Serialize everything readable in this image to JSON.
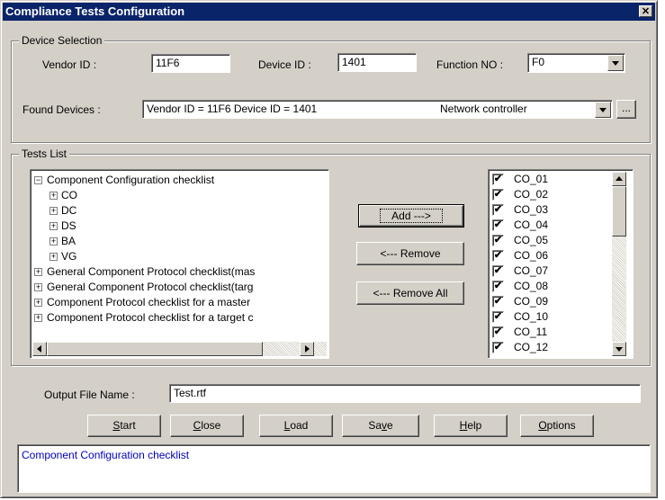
{
  "window": {
    "title": "Compliance Tests Configuration",
    "close_glyph": "✕"
  },
  "device_selection": {
    "legend": "Device Selection",
    "vendor_label": "Vendor ID :",
    "vendor_value": "11F6",
    "device_label": "Device ID :",
    "device_value": "1401",
    "function_label": "Function NO :",
    "function_value": "F0",
    "found_label": "Found Devices :",
    "found_value": "Vendor ID = 11F6 Device ID = 1401",
    "found_class": "Network controller",
    "browse_label": "..."
  },
  "tests_list": {
    "legend": "Tests List",
    "tree": [
      {
        "label": "Component Configuration checklist",
        "expander": "−",
        "level": 0
      },
      {
        "label": "CO",
        "expander": "+",
        "level": 1
      },
      {
        "label": "DC",
        "expander": "+",
        "level": 1
      },
      {
        "label": "DS",
        "expander": "+",
        "level": 1
      },
      {
        "label": "BA",
        "expander": "+",
        "level": 1
      },
      {
        "label": "VG",
        "expander": "+",
        "level": 1
      },
      {
        "label": "General Component Protocol checklist(mas",
        "expander": "+",
        "level": 0
      },
      {
        "label": "General Component Protocol checklist(targ",
        "expander": "+",
        "level": 0
      },
      {
        "label": "Component Protocol checklist for a master",
        "expander": "+",
        "level": 0
      },
      {
        "label": "Component Protocol checklist for a target c",
        "expander": "+",
        "level": 0
      }
    ],
    "add_label": "Add --->",
    "remove_label": "<--- Remove",
    "remove_all_label": "<--- Remove All",
    "selected": [
      {
        "label": "CO_01",
        "checked": true
      },
      {
        "label": "CO_02",
        "checked": true
      },
      {
        "label": "CO_03",
        "checked": true
      },
      {
        "label": "CO_04",
        "checked": true
      },
      {
        "label": "CO_05",
        "checked": true
      },
      {
        "label": "CO_06",
        "checked": true
      },
      {
        "label": "CO_07",
        "checked": true
      },
      {
        "label": "CO_08",
        "checked": true
      },
      {
        "label": "CO_09",
        "checked": true
      },
      {
        "label": "CO_10",
        "checked": true
      },
      {
        "label": "CO_11",
        "checked": true
      },
      {
        "label": "CO_12",
        "checked": true
      }
    ],
    "check_glyph": "✔"
  },
  "output": {
    "label": "Output File Name :",
    "value": "Test.rtf"
  },
  "buttons": {
    "start": {
      "mn": "S",
      "rest": "tart"
    },
    "close": {
      "mn": "C",
      "rest": "lose"
    },
    "load": {
      "mn": "L",
      "rest": "oad"
    },
    "save": {
      "pre": "Sa",
      "mn": "v",
      "rest": "e"
    },
    "help": {
      "mn": "H",
      "rest": "elp"
    },
    "options": {
      "mn": "O",
      "rest": "ptions"
    }
  },
  "status_text": "Component Configuration checklist"
}
